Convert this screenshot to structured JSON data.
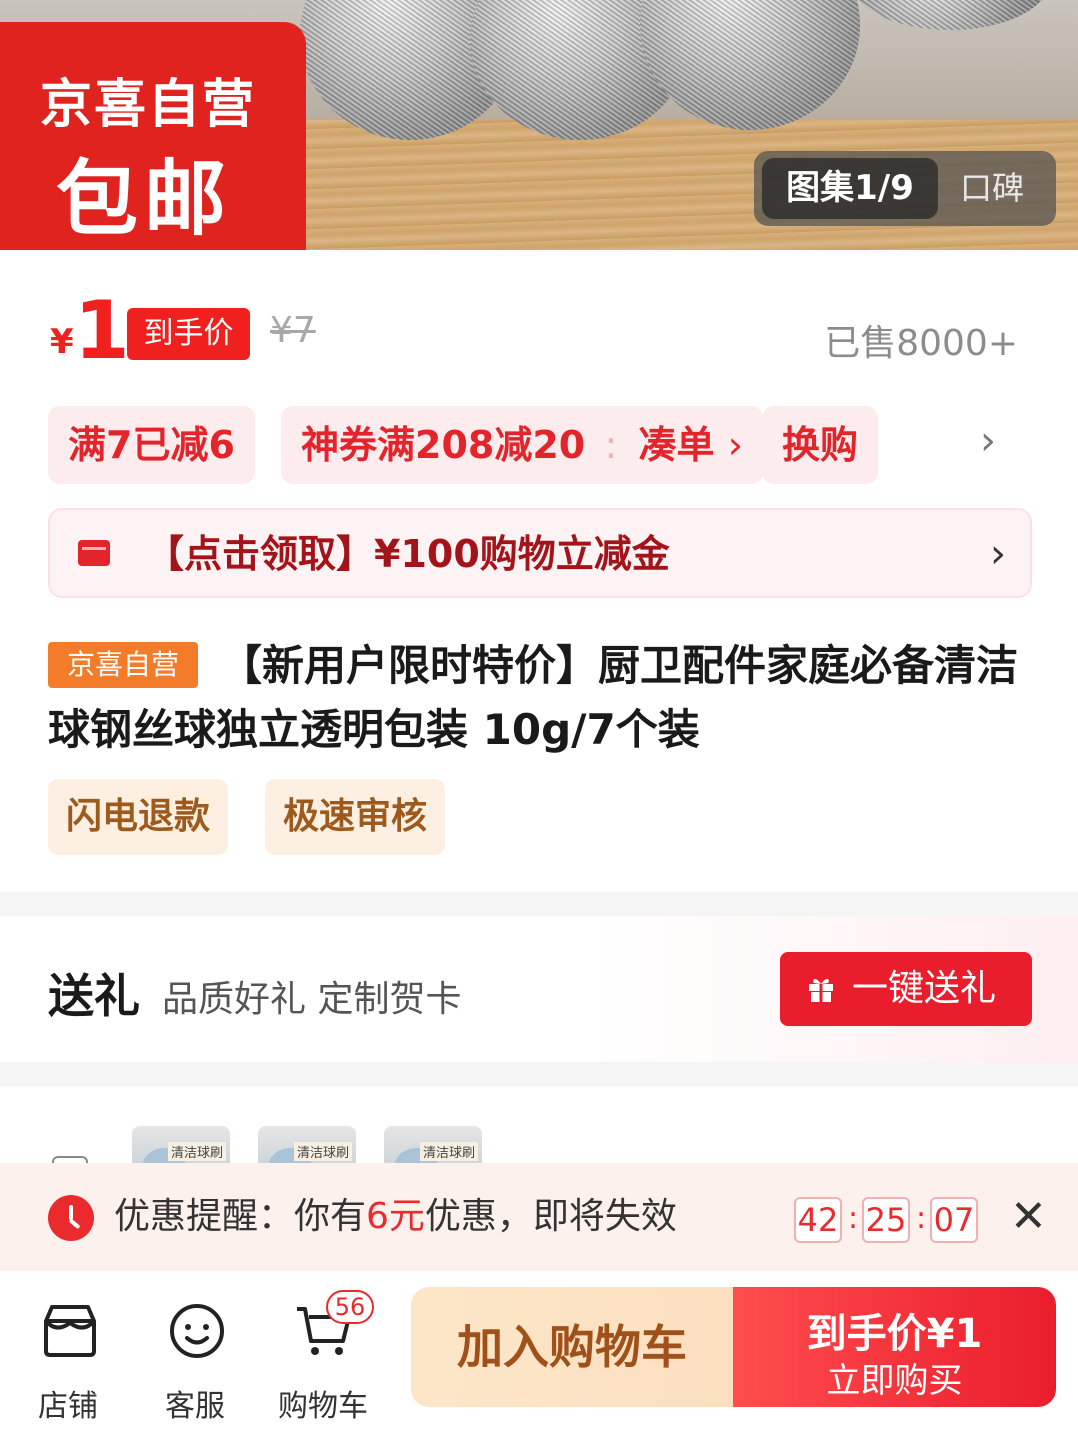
{
  "hero": {
    "badge_line1": "京喜自营",
    "badge_line2": "包邮",
    "gallery_label": "图集1/9",
    "reviews_tab": "口碑"
  },
  "price": {
    "currency": "¥",
    "value": "1",
    "tag": "到手价",
    "original": "¥7",
    "sold": "已售8000+"
  },
  "promos": {
    "items": [
      {
        "label": "满7已减6"
      },
      {
        "label": "神券满208减20",
        "action": "凑单"
      },
      {
        "label": "换购"
      }
    ],
    "more_icon": "chevron-right-icon"
  },
  "coupon": {
    "text": "【点击领取】¥100购物立减金",
    "icon": "card-icon"
  },
  "product": {
    "tag": "京喜自营",
    "title": "【新用户限时特价】厨卫配件家庭必备清洁球钢丝球独立透明包装 10g/7个装",
    "services": [
      "闪电退款",
      "极速审核"
    ]
  },
  "gift": {
    "heading": "送礼",
    "subtitle": "品质好礼 定制贺卡",
    "button": "一键送礼"
  },
  "hidden_section": {
    "thumb_label": "清洁球刷"
  },
  "reminder": {
    "prefix": "优惠提醒：你有",
    "amount": "6元",
    "suffix": "优惠，即将失效",
    "countdown": {
      "h": "42",
      "m": "25",
      "s": "07"
    },
    "separator": ":"
  },
  "bottom_bar": {
    "shop": "店铺",
    "service": "客服",
    "cart": "购物车",
    "cart_count": "56",
    "add_to_cart": "加入购物车",
    "buy_price": "到手价¥1",
    "buy_now": "立即购买"
  },
  "colors": {
    "accent_red": "#f0201f",
    "tag_orange": "#f47b2a",
    "service_brown": "#9e5a1d"
  }
}
